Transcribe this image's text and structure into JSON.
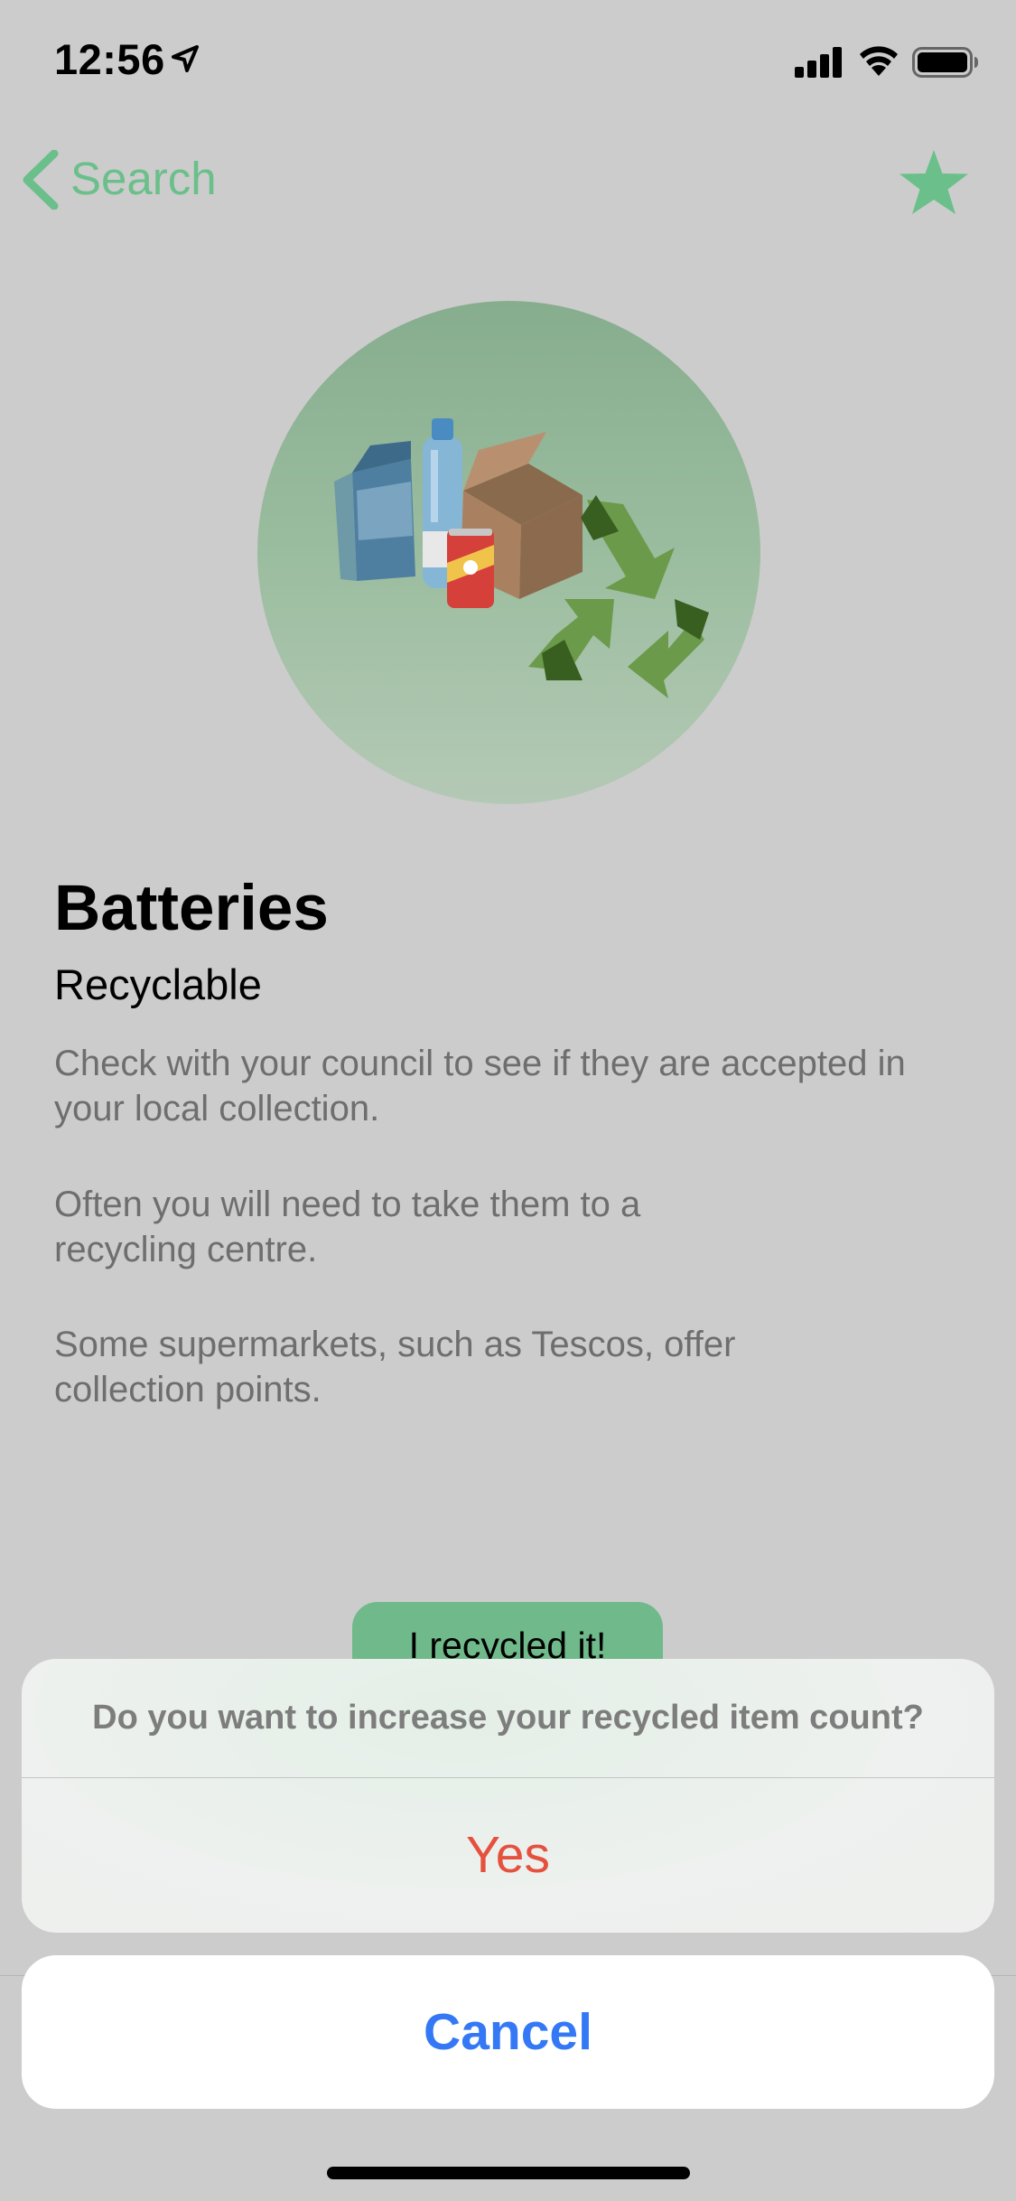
{
  "status_bar": {
    "time": "12:56",
    "location_icon": "location-arrow-icon",
    "signal_icon": "cellular-signal-icon",
    "wifi_icon": "wifi-icon",
    "battery_icon": "battery-icon"
  },
  "nav": {
    "back_label": "Search",
    "back_icon": "chevron-left-icon",
    "favorite_icon": "star-icon"
  },
  "item": {
    "title": "Batteries",
    "status": "Recyclable",
    "paragraphs": [
      "Check with your council to see if they are accepted in your local collection.",
      "Often you will need to take them to a recycling centre.",
      "Some supermarkets, such as Tescos, offer collection points."
    ],
    "recycled_button": "I recycled it!"
  },
  "action_sheet": {
    "message": "Do you want to increase your recycled item count?",
    "confirm_label": "Yes",
    "cancel_label": "Cancel"
  },
  "colors": {
    "accent_green": "#6bbf8a",
    "destructive_red": "#e5513e",
    "cancel_blue": "#3478f6",
    "background": "#cccccc"
  }
}
